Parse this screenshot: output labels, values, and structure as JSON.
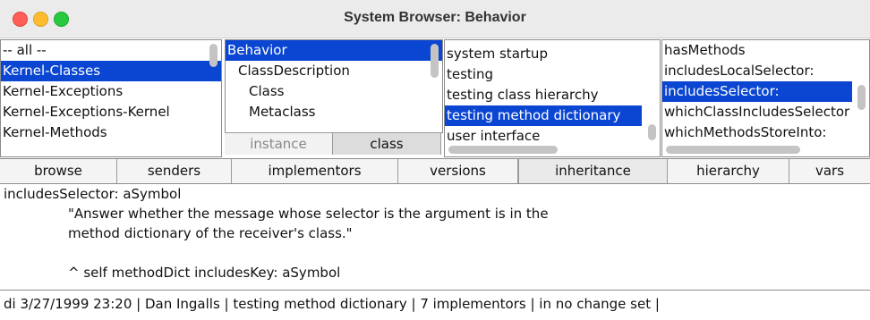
{
  "window": {
    "title": "System Browser: Behavior"
  },
  "panes": {
    "categories": [
      "-- all --",
      "Kernel-Classes",
      "Kernel-Exceptions",
      "Kernel-Exceptions-Kernel",
      "Kernel-Methods"
    ],
    "classes": [
      "Behavior",
      "ClassDescription",
      "Class",
      "Metaclass"
    ],
    "protocols": [
      "system startup",
      "testing",
      "testing class hierarchy",
      "testing method dictionary",
      "user interface"
    ],
    "methods": [
      "hasMethods",
      "includesLocalSelector:",
      "includesSelector:",
      "whichClassIncludesSelector",
      "whichMethodsStoreInto:"
    ]
  },
  "toggles": {
    "instance": "instance",
    "class": "class"
  },
  "buttons": [
    "browse",
    "senders",
    "implementors",
    "versions",
    "inheritance",
    "hierarchy",
    "vars"
  ],
  "code": {
    "l1": "includesSelector: aSymbol",
    "l2": "\"Answer whether the message whose selector is the argument is in the",
    "l3": "method dictionary of the receiver's class.\"",
    "l4": "",
    "l5": "^ self methodDict includesKey: aSymbol"
  },
  "status": "di 3/27/1999 23:20 | Dan Ingalls | testing method dictionary | 7 implementors | in no change set |",
  "colors": {
    "selection": "#0a46d2"
  }
}
